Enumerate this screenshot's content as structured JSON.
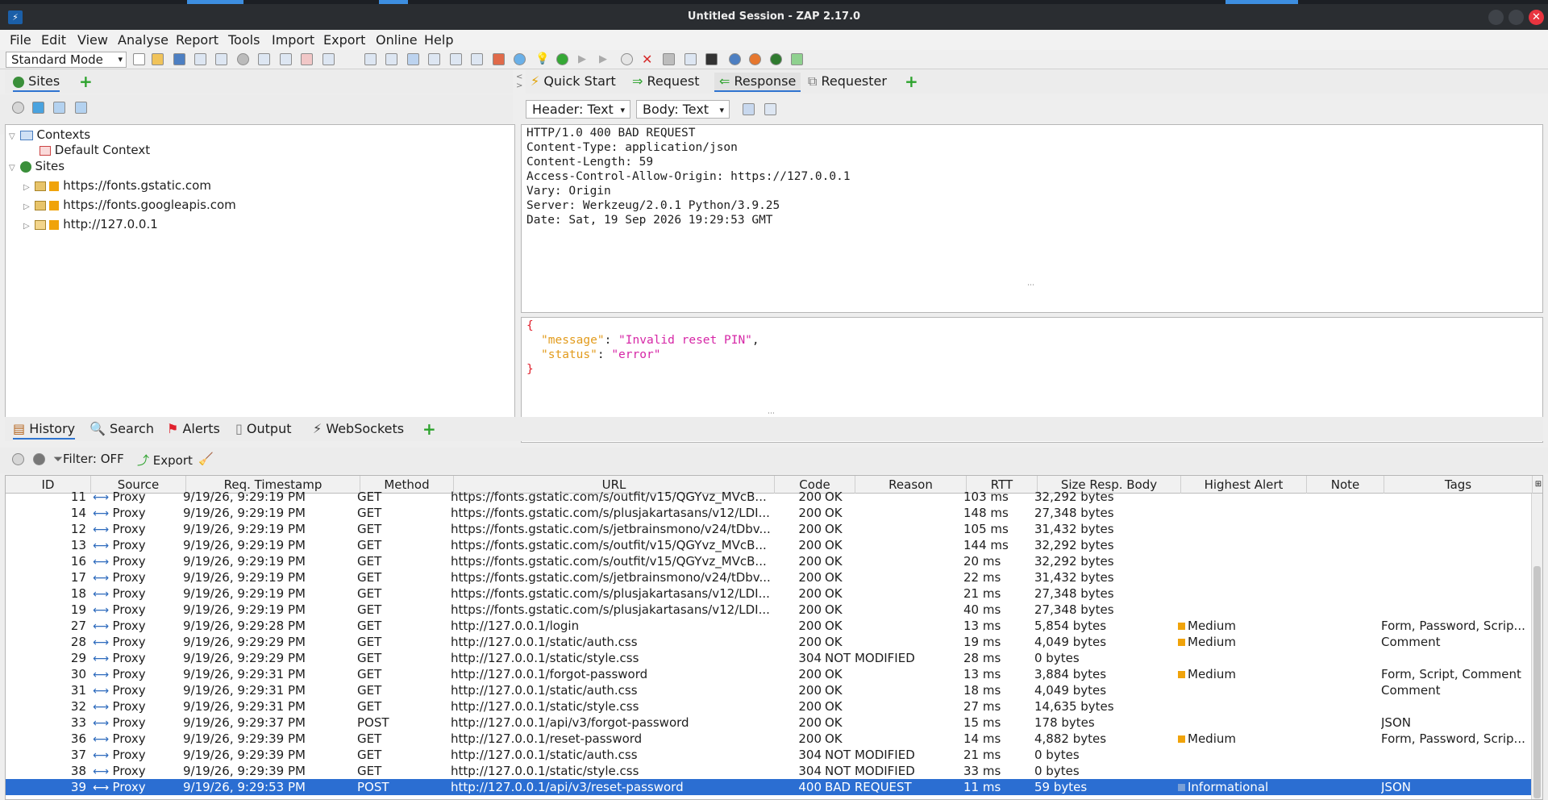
{
  "window": {
    "title": "Untitled Session - ZAP 2.17.0"
  },
  "menu": [
    "File",
    "Edit",
    "View",
    "Analyse",
    "Report",
    "Tools",
    "Import",
    "Export",
    "Online",
    "Help"
  ],
  "toolbar": {
    "mode": "Standard Mode"
  },
  "sites_panel": {
    "tab": "Sites",
    "contexts": "Contexts",
    "default_context": "Default Context",
    "sites": "Sites",
    "site_items": [
      "https://fonts.gstatic.com",
      "https://fonts.googleapis.com",
      "http://127.0.0.1"
    ]
  },
  "work_tabs": {
    "quick_start": "Quick Start",
    "request": "Request",
    "response": "Response",
    "requester": "Requester"
  },
  "response": {
    "header_select": "Header: Text",
    "body_select": "Body: Text",
    "header_lines": [
      "HTTP/1.0 400 BAD REQUEST",
      "Content-Type: application/json",
      "Content-Length: 59",
      "Access-Control-Allow-Origin: https://127.0.0.1",
      "Vary: Origin",
      "Server: Werkzeug/2.0.1 Python/3.9.25",
      "Date: Sat, 19 Sep 2026 19:29:53 GMT"
    ],
    "body": {
      "open": "{",
      "close": "}",
      "k1": "\"message\"",
      "v1": "\"Invalid reset PIN\"",
      "k2": "\"status\"",
      "v2": "\"error\"",
      "colon": ": ",
      "comma": ","
    }
  },
  "bottom_tabs": {
    "history": "History",
    "search": "Search",
    "alerts": "Alerts",
    "output": "Output",
    "websockets": "WebSockets"
  },
  "history_toolbar": {
    "filter": "Filter: OFF",
    "export": "Export"
  },
  "table": {
    "columns": [
      "ID",
      "Source",
      "Req. Timestamp",
      "Method",
      "URL",
      "Code",
      "Reason",
      "RTT",
      "Size Resp. Body",
      "Highest Alert",
      "Note",
      "Tags"
    ],
    "rows": [
      {
        "id": "11",
        "source": "Proxy",
        "ts": "9/19/26, 9:29:19 PM",
        "method": "GET",
        "url": "https://fonts.gstatic.com/s/outfit/v15/QGYvz_MVcB...",
        "code": "200",
        "reason": "OK",
        "rtt": "103 ms",
        "size": "32,292 bytes",
        "alert": "",
        "alert_flag": "",
        "note": "",
        "tags": ""
      },
      {
        "id": "14",
        "source": "Proxy",
        "ts": "9/19/26, 9:29:19 PM",
        "method": "GET",
        "url": "https://fonts.gstatic.com/s/plusjakartasans/v12/LDI...",
        "code": "200",
        "reason": "OK",
        "rtt": "148 ms",
        "size": "27,348 bytes",
        "alert": "",
        "alert_flag": "",
        "note": "",
        "tags": ""
      },
      {
        "id": "12",
        "source": "Proxy",
        "ts": "9/19/26, 9:29:19 PM",
        "method": "GET",
        "url": "https://fonts.gstatic.com/s/jetbrainsmono/v24/tDbv...",
        "code": "200",
        "reason": "OK",
        "rtt": "105 ms",
        "size": "31,432 bytes",
        "alert": "",
        "alert_flag": "",
        "note": "",
        "tags": ""
      },
      {
        "id": "13",
        "source": "Proxy",
        "ts": "9/19/26, 9:29:19 PM",
        "method": "GET",
        "url": "https://fonts.gstatic.com/s/outfit/v15/QGYvz_MVcB...",
        "code": "200",
        "reason": "OK",
        "rtt": "144 ms",
        "size": "32,292 bytes",
        "alert": "",
        "alert_flag": "",
        "note": "",
        "tags": ""
      },
      {
        "id": "16",
        "source": "Proxy",
        "ts": "9/19/26, 9:29:19 PM",
        "method": "GET",
        "url": "https://fonts.gstatic.com/s/outfit/v15/QGYvz_MVcB...",
        "code": "200",
        "reason": "OK",
        "rtt": "20 ms",
        "size": "32,292 bytes",
        "alert": "",
        "alert_flag": "",
        "note": "",
        "tags": ""
      },
      {
        "id": "17",
        "source": "Proxy",
        "ts": "9/19/26, 9:29:19 PM",
        "method": "GET",
        "url": "https://fonts.gstatic.com/s/jetbrainsmono/v24/tDbv...",
        "code": "200",
        "reason": "OK",
        "rtt": "22 ms",
        "size": "31,432 bytes",
        "alert": "",
        "alert_flag": "",
        "note": "",
        "tags": ""
      },
      {
        "id": "18",
        "source": "Proxy",
        "ts": "9/19/26, 9:29:19 PM",
        "method": "GET",
        "url": "https://fonts.gstatic.com/s/plusjakartasans/v12/LDI...",
        "code": "200",
        "reason": "OK",
        "rtt": "21 ms",
        "size": "27,348 bytes",
        "alert": "",
        "alert_flag": "",
        "note": "",
        "tags": ""
      },
      {
        "id": "19",
        "source": "Proxy",
        "ts": "9/19/26, 9:29:19 PM",
        "method": "GET",
        "url": "https://fonts.gstatic.com/s/plusjakartasans/v12/LDI...",
        "code": "200",
        "reason": "OK",
        "rtt": "40 ms",
        "size": "27,348 bytes",
        "alert": "",
        "alert_flag": "",
        "note": "",
        "tags": ""
      },
      {
        "id": "27",
        "source": "Proxy",
        "ts": "9/19/26, 9:29:28 PM",
        "method": "GET",
        "url": "http://127.0.0.1/login",
        "code": "200",
        "reason": "OK",
        "rtt": "13 ms",
        "size": "5,854 bytes",
        "alert": "Medium",
        "alert_flag": "medium",
        "note": "",
        "tags": "Form, Password, Scrip..."
      },
      {
        "id": "28",
        "source": "Proxy",
        "ts": "9/19/26, 9:29:29 PM",
        "method": "GET",
        "url": "http://127.0.0.1/static/auth.css",
        "code": "200",
        "reason": "OK",
        "rtt": "19 ms",
        "size": "4,049 bytes",
        "alert": "Medium",
        "alert_flag": "medium",
        "note": "",
        "tags": "Comment"
      },
      {
        "id": "29",
        "source": "Proxy",
        "ts": "9/19/26, 9:29:29 PM",
        "method": "GET",
        "url": "http://127.0.0.1/static/style.css",
        "code": "304",
        "reason": "NOT MODIFIED",
        "rtt": "28 ms",
        "size": "0 bytes",
        "alert": "",
        "alert_flag": "",
        "note": "",
        "tags": ""
      },
      {
        "id": "30",
        "source": "Proxy",
        "ts": "9/19/26, 9:29:31 PM",
        "method": "GET",
        "url": "http://127.0.0.1/forgot-password",
        "code": "200",
        "reason": "OK",
        "rtt": "13 ms",
        "size": "3,884 bytes",
        "alert": "Medium",
        "alert_flag": "medium",
        "note": "",
        "tags": "Form, Script, Comment"
      },
      {
        "id": "31",
        "source": "Proxy",
        "ts": "9/19/26, 9:29:31 PM",
        "method": "GET",
        "url": "http://127.0.0.1/static/auth.css",
        "code": "200",
        "reason": "OK",
        "rtt": "18 ms",
        "size": "4,049 bytes",
        "alert": "",
        "alert_flag": "",
        "note": "",
        "tags": "Comment"
      },
      {
        "id": "32",
        "source": "Proxy",
        "ts": "9/19/26, 9:29:31 PM",
        "method": "GET",
        "url": "http://127.0.0.1/static/style.css",
        "code": "200",
        "reason": "OK",
        "rtt": "27 ms",
        "size": "14,635 bytes",
        "alert": "",
        "alert_flag": "",
        "note": "",
        "tags": ""
      },
      {
        "id": "33",
        "source": "Proxy",
        "ts": "9/19/26, 9:29:37 PM",
        "method": "POST",
        "url": "http://127.0.0.1/api/v3/forgot-password",
        "code": "200",
        "reason": "OK",
        "rtt": "15 ms",
        "size": "178 bytes",
        "alert": "",
        "alert_flag": "",
        "note": "",
        "tags": "JSON"
      },
      {
        "id": "36",
        "source": "Proxy",
        "ts": "9/19/26, 9:29:39 PM",
        "method": "GET",
        "url": "http://127.0.0.1/reset-password",
        "code": "200",
        "reason": "OK",
        "rtt": "14 ms",
        "size": "4,882 bytes",
        "alert": "Medium",
        "alert_flag": "medium",
        "note": "",
        "tags": "Form, Password, Scrip..."
      },
      {
        "id": "37",
        "source": "Proxy",
        "ts": "9/19/26, 9:29:39 PM",
        "method": "GET",
        "url": "http://127.0.0.1/static/auth.css",
        "code": "304",
        "reason": "NOT MODIFIED",
        "rtt": "21 ms",
        "size": "0 bytes",
        "alert": "",
        "alert_flag": "",
        "note": "",
        "tags": ""
      },
      {
        "id": "38",
        "source": "Proxy",
        "ts": "9/19/26, 9:29:39 PM",
        "method": "GET",
        "url": "http://127.0.0.1/static/style.css",
        "code": "304",
        "reason": "NOT MODIFIED",
        "rtt": "33 ms",
        "size": "0 bytes",
        "alert": "",
        "alert_flag": "",
        "note": "",
        "tags": ""
      },
      {
        "id": "39",
        "source": "Proxy",
        "ts": "9/19/26, 9:29:53 PM",
        "method": "POST",
        "url": "http://127.0.0.1/api/v3/reset-password",
        "code": "400",
        "reason": "BAD REQUEST",
        "rtt": "11 ms",
        "size": "59 bytes",
        "alert": "Informational",
        "alert_flag": "info",
        "note": "",
        "tags": "JSON"
      }
    ],
    "selected_id": "39"
  },
  "colors": {
    "accent": "#2b6ed2",
    "json_brace": "#e0202c",
    "json_key": "#e29b1c",
    "json_string": "#d626a6",
    "titlebar": "#2a2d31"
  }
}
